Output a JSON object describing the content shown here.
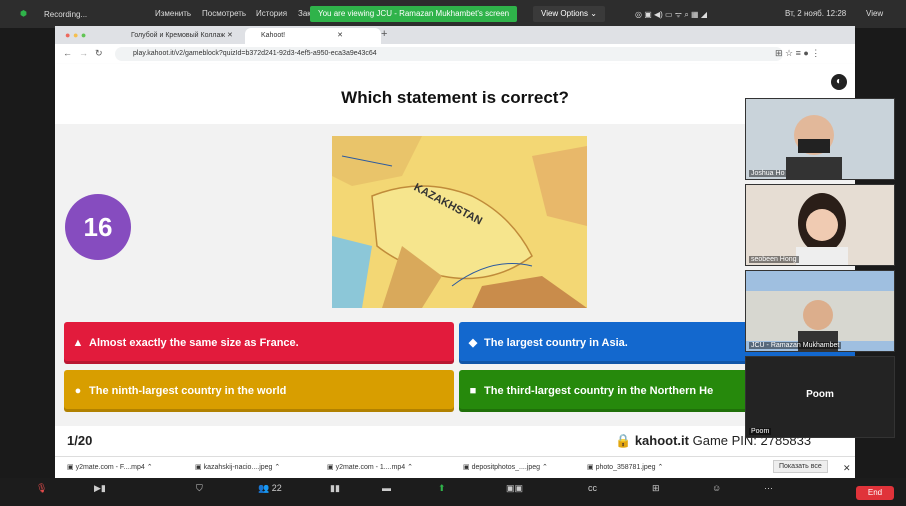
{
  "menubar": {
    "items": [
      "Изменить",
      "Посмотреть",
      "История",
      "Зак"
    ],
    "recording": "Recording...",
    "share_banner": "You are viewing JCU - Ramazan Mukhambet's screen",
    "view_options": "View Options",
    "clock": "Вт, 2 нояб. 12:28",
    "view": "View"
  },
  "browser": {
    "tabs": [
      {
        "label": "Голубой и Кремовый Коллаж"
      },
      {
        "label": "Kahoot!"
      }
    ],
    "url": "play.kahoot.it/v2/gameblock?quizId=b372d241-92d3-4ef5-a950-eca3a9e43c64"
  },
  "kahoot": {
    "question": "Which statement is correct?",
    "timer": "16",
    "answers": [
      {
        "shape": "▲",
        "text": "Almost exactly the same size as France.",
        "color": "#e21b3c"
      },
      {
        "shape": "◆",
        "text": "The largest country in Asia.",
        "color": "#1368ce"
      },
      {
        "shape": "●",
        "text": "The ninth-largest country in the world",
        "color": "#d89e00"
      },
      {
        "shape": "■",
        "text": "The third-largest country in the Northern He",
        "color": "#26890c"
      }
    ],
    "counter": "1/20",
    "pin_prefix": "kahoot.it",
    "pin_rest": "Game PIN: 2785833",
    "map_label": "KAZAKHSTAN"
  },
  "downloads": {
    "files": [
      "y2mate.com - F....mp4",
      "kazahskij-nacio....jpeg",
      "y2mate.com - 1....mp4",
      "depositphotos_....jpeg",
      "photo_358781.jpeg"
    ],
    "show_all": "Показать все"
  },
  "participants": [
    {
      "name": "Joshua Ho"
    },
    {
      "name": "seobeen Hong"
    },
    {
      "name": "JCU - Ramazan Mukhambet"
    },
    {
      "name": "Poom"
    }
  ],
  "zoombar": {
    "count": "22",
    "end": "End"
  }
}
